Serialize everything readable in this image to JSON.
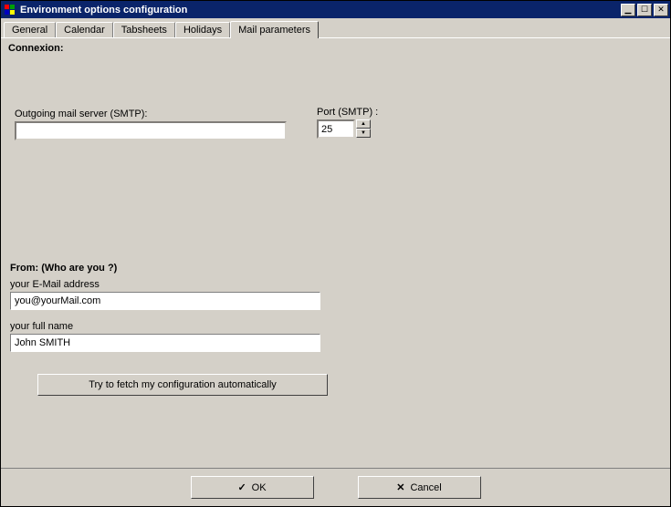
{
  "window": {
    "title": "Environment options configuration"
  },
  "tabs": {
    "general": "General",
    "calendar": "Calendar",
    "tabsheets": "Tabsheets",
    "holidays": "Holidays",
    "mail": "Mail parameters"
  },
  "connexion": {
    "heading": "Connexion:",
    "smtp_label": "Outgoing mail server (SMTP):",
    "smtp_value": "",
    "port_label": "Port  (SMTP) :",
    "port_value": "25"
  },
  "from": {
    "heading": "From: (Who are you ?)",
    "email_label": "your E-Mail address",
    "email_value": "you@yourMail.com",
    "name_label": "your full name",
    "name_value": "John SMITH",
    "fetch_button": "Try to fetch my configuration automatically"
  },
  "buttons": {
    "ok": "OK",
    "cancel": "Cancel"
  }
}
